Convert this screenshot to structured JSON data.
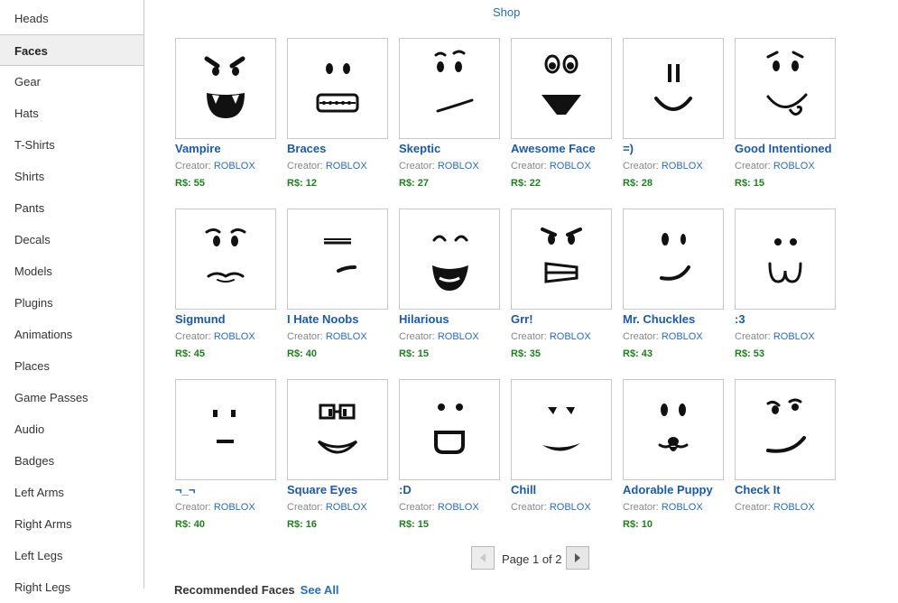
{
  "sidebar": {
    "items": [
      {
        "label": "Heads"
      },
      {
        "label": "Faces"
      },
      {
        "label": "Gear"
      },
      {
        "label": "Hats"
      },
      {
        "label": "T-Shirts"
      },
      {
        "label": "Shirts"
      },
      {
        "label": "Pants"
      },
      {
        "label": "Decals"
      },
      {
        "label": "Models"
      },
      {
        "label": "Plugins"
      },
      {
        "label": "Animations"
      },
      {
        "label": "Places"
      },
      {
        "label": "Game Passes"
      },
      {
        "label": "Audio"
      },
      {
        "label": "Badges"
      },
      {
        "label": "Left Arms"
      },
      {
        "label": "Right Arms"
      },
      {
        "label": "Left Legs"
      },
      {
        "label": "Right Legs"
      }
    ],
    "active": "Faces"
  },
  "header": {
    "shop_label": "Shop"
  },
  "items": [
    {
      "name": "Vampire",
      "creator_label": "Creator:",
      "creator": "ROBLOX",
      "price": "R$: 55",
      "icon": "vampire-face-icon"
    },
    {
      "name": "Braces",
      "creator_label": "Creator:",
      "creator": "ROBLOX",
      "price": "R$: 12",
      "icon": "braces-face-icon"
    },
    {
      "name": "Skeptic",
      "creator_label": "Creator:",
      "creator": "ROBLOX",
      "price": "R$: 27",
      "icon": "skeptic-face-icon"
    },
    {
      "name": "Awesome Face",
      "creator_label": "Creator:",
      "creator": "ROBLOX",
      "price": "R$: 22",
      "icon": "awesome-face-icon"
    },
    {
      "name": "=)",
      "creator_label": "Creator:",
      "creator": "ROBLOX",
      "price": "R$: 28",
      "icon": "equals-smile-face-icon"
    },
    {
      "name": "Good Intentioned",
      "creator_label": "Creator:",
      "creator": "ROBLOX",
      "price": "R$: 15",
      "icon": "good-intentioned-face-icon"
    },
    {
      "name": "Sigmund",
      "creator_label": "Creator:",
      "creator": "ROBLOX",
      "price": "R$: 45",
      "icon": "sigmund-face-icon"
    },
    {
      "name": "I Hate Noobs",
      "creator_label": "Creator:",
      "creator": "ROBLOX",
      "price": "R$: 40",
      "icon": "i-hate-noobs-face-icon"
    },
    {
      "name": "Hilarious",
      "creator_label": "Creator:",
      "creator": "ROBLOX",
      "price": "R$: 15",
      "icon": "hilarious-face-icon"
    },
    {
      "name": "Grr!",
      "creator_label": "Creator:",
      "creator": "ROBLOX",
      "price": "R$: 35",
      "icon": "grr-face-icon"
    },
    {
      "name": "Mr. Chuckles",
      "creator_label": "Creator:",
      "creator": "ROBLOX",
      "price": "R$: 43",
      "icon": "mr-chuckles-face-icon"
    },
    {
      "name": ":3",
      "creator_label": "Creator:",
      "creator": "ROBLOX",
      "price": "R$: 53",
      "icon": "cat-mouth-face-icon"
    },
    {
      "name": "¬_¬",
      "creator_label": "Creator:",
      "creator": "ROBLOX",
      "price": "R$: 40",
      "icon": "side-eye-face-icon"
    },
    {
      "name": "Square Eyes",
      "creator_label": "Creator:",
      "creator": "ROBLOX",
      "price": "R$: 16",
      "icon": "square-eyes-face-icon"
    },
    {
      "name": ":D",
      "creator_label": "Creator:",
      "creator": "ROBLOX",
      "price": "R$: 15",
      "icon": "big-grin-face-icon"
    },
    {
      "name": "Chill",
      "creator_label": "Creator:",
      "creator": "ROBLOX",
      "price": "",
      "icon": "chill-face-icon"
    },
    {
      "name": "Adorable Puppy",
      "creator_label": "Creator:",
      "creator": "ROBLOX",
      "price": "R$: 10",
      "icon": "adorable-puppy-face-icon"
    },
    {
      "name": "Check It",
      "creator_label": "Creator:",
      "creator": "ROBLOX",
      "price": "",
      "icon": "check-it-face-icon"
    }
  ],
  "pager": {
    "text": "Page 1 of 2"
  },
  "recommended": {
    "title": "Recommended Faces",
    "see_all": "See All"
  },
  "colors": {
    "link": "#1c5aa8",
    "price": "#1f7e1f",
    "border": "#c8c8c8"
  }
}
